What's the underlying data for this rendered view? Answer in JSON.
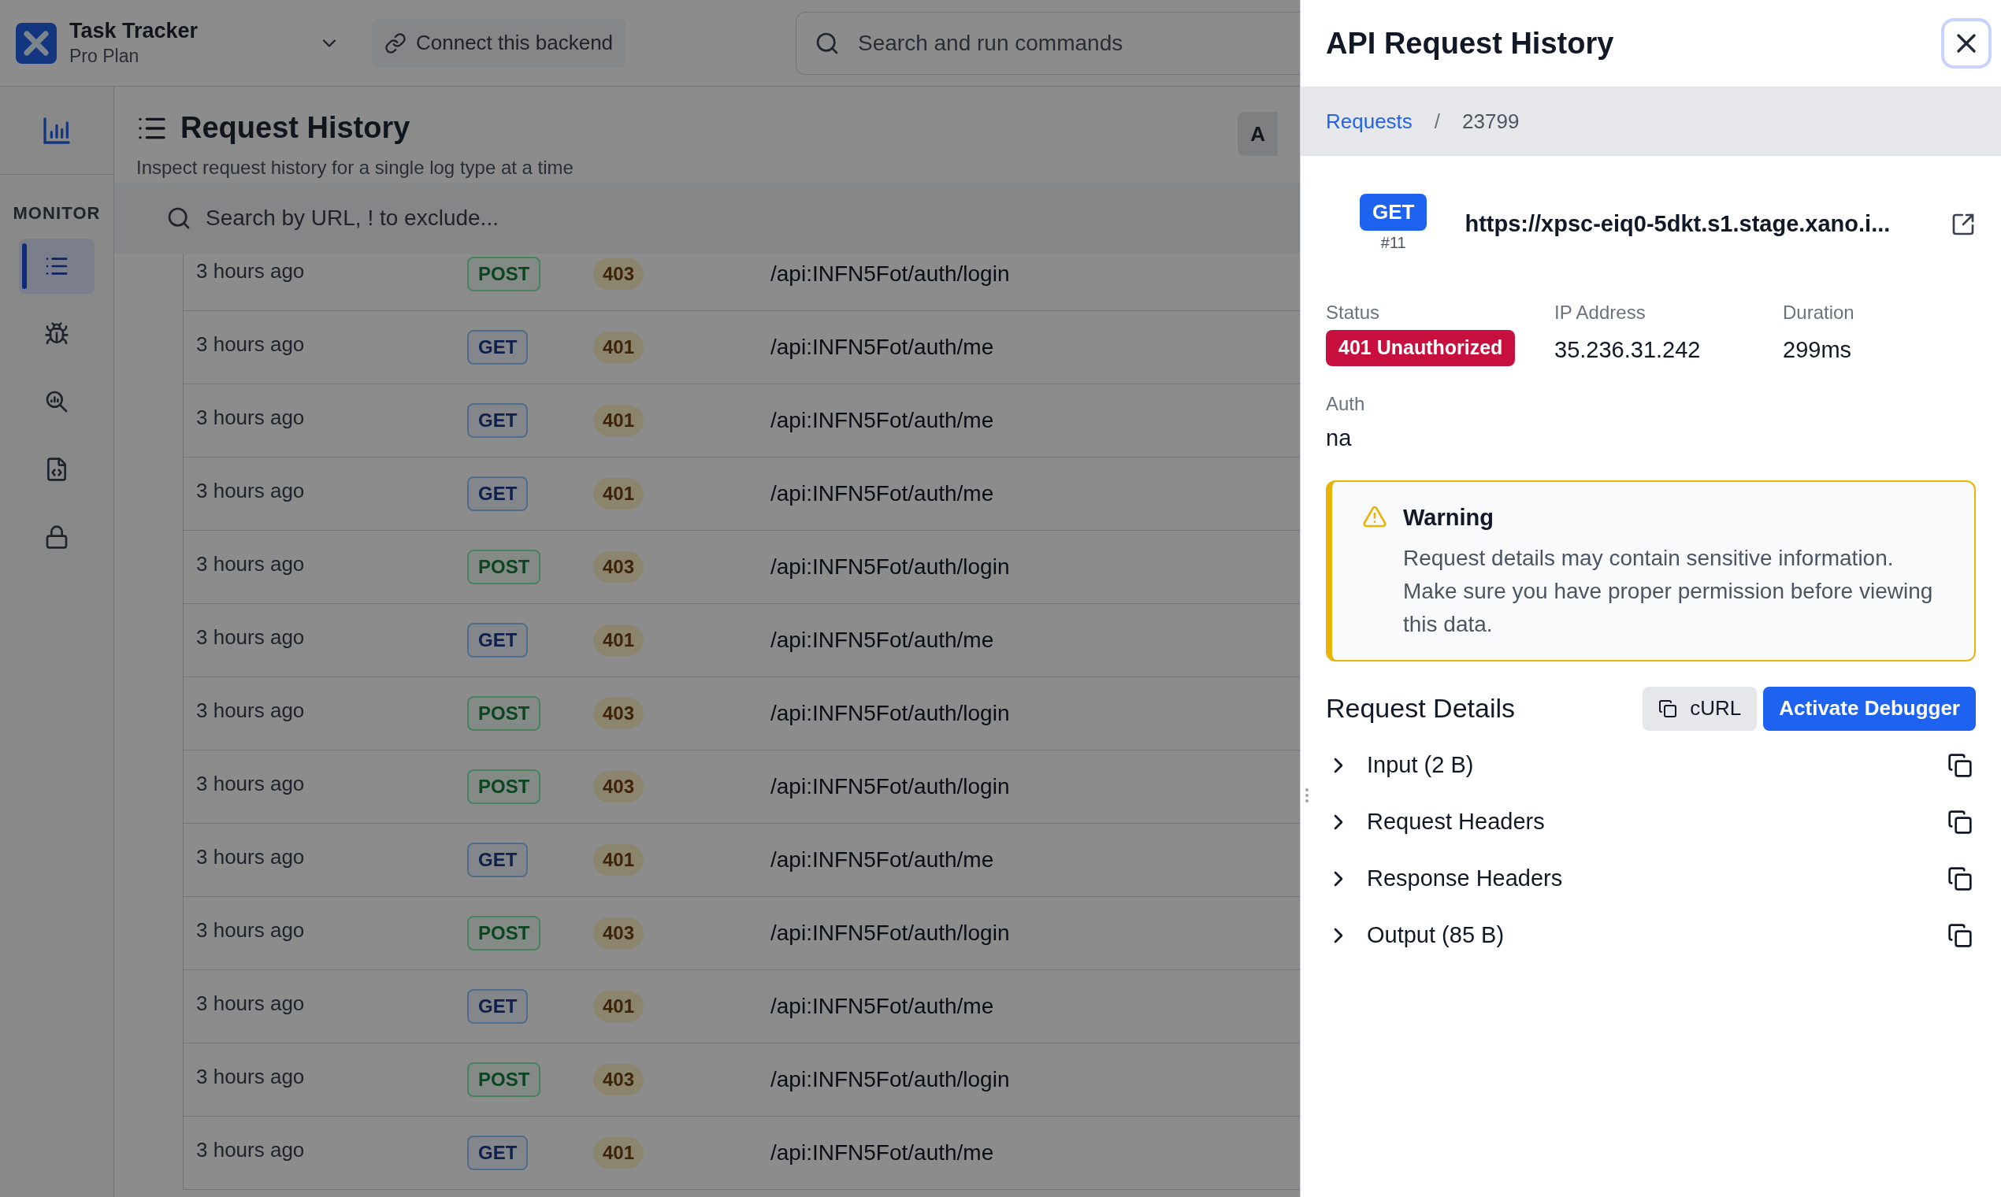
{
  "topbar": {
    "app_name": "Task Tracker",
    "plan": "Pro Plan",
    "connect_button": "Connect this backend",
    "search": {
      "placeholder": "Search and run commands"
    }
  },
  "sidebar": {
    "section_label": "MONITOR",
    "items": [
      {
        "kind": "list",
        "selected": true
      },
      {
        "kind": "bug",
        "selected": false
      },
      {
        "kind": "inspect",
        "selected": false
      },
      {
        "kind": "file",
        "selected": false
      },
      {
        "kind": "lock",
        "selected": false
      }
    ]
  },
  "page": {
    "title": "Request History",
    "subtitle": "Inspect request history for a single log type at a time",
    "cut_button": "A",
    "search": {
      "placeholder": "Search by URL, ! to exclude..."
    }
  },
  "rows": [
    {
      "time": "3 hours ago",
      "method": {
        "label": "POST",
        "kind": "post"
      },
      "status": "403",
      "path": "/api:INFN5Fot/auth/login"
    },
    {
      "time": "3 hours ago",
      "method": {
        "label": "GET",
        "kind": "get"
      },
      "status": "401",
      "path": "/api:INFN5Fot/auth/me"
    },
    {
      "time": "3 hours ago",
      "method": {
        "label": "GET",
        "kind": "get"
      },
      "status": "401",
      "path": "/api:INFN5Fot/auth/me"
    },
    {
      "time": "3 hours ago",
      "method": {
        "label": "GET",
        "kind": "get"
      },
      "status": "401",
      "path": "/api:INFN5Fot/auth/me"
    },
    {
      "time": "3 hours ago",
      "method": {
        "label": "POST",
        "kind": "post"
      },
      "status": "403",
      "path": "/api:INFN5Fot/auth/login"
    },
    {
      "time": "3 hours ago",
      "method": {
        "label": "GET",
        "kind": "get"
      },
      "status": "401",
      "path": "/api:INFN5Fot/auth/me"
    },
    {
      "time": "3 hours ago",
      "method": {
        "label": "POST",
        "kind": "post"
      },
      "status": "403",
      "path": "/api:INFN5Fot/auth/login"
    },
    {
      "time": "3 hours ago",
      "method": {
        "label": "POST",
        "kind": "post"
      },
      "status": "403",
      "path": "/api:INFN5Fot/auth/login"
    },
    {
      "time": "3 hours ago",
      "method": {
        "label": "GET",
        "kind": "get"
      },
      "status": "401",
      "path": "/api:INFN5Fot/auth/me"
    },
    {
      "time": "3 hours ago",
      "method": {
        "label": "POST",
        "kind": "post"
      },
      "status": "403",
      "path": "/api:INFN5Fot/auth/login"
    },
    {
      "time": "3 hours ago",
      "method": {
        "label": "GET",
        "kind": "get"
      },
      "status": "401",
      "path": "/api:INFN5Fot/auth/me"
    },
    {
      "time": "3 hours ago",
      "method": {
        "label": "POST",
        "kind": "post"
      },
      "status": "403",
      "path": "/api:INFN5Fot/auth/login"
    },
    {
      "time": "3 hours ago",
      "method": {
        "label": "GET",
        "kind": "get"
      },
      "status": "401",
      "path": "/api:INFN5Fot/auth/me"
    }
  ],
  "panel": {
    "title": "API Request History",
    "breadcrumb": {
      "link": "Requests",
      "separator": "/",
      "current": "23799"
    },
    "request": {
      "method": "GET",
      "number": "#11",
      "url": "https://xpsc-eiq0-5dkt.s1.stage.xano.i..."
    },
    "fields": [
      {
        "label": "Status",
        "value": "401 Unauthorized",
        "kind": "badge"
      },
      {
        "label": "IP Address",
        "value": "35.236.31.242",
        "kind": "text"
      },
      {
        "label": "Duration",
        "value": "299ms",
        "kind": "text"
      }
    ],
    "auth": {
      "label": "Auth",
      "value": "na"
    },
    "warning": {
      "title": "Warning",
      "text": "Request details may contain sensitive information. Make sure you have proper permission before viewing this data."
    },
    "details": {
      "title": "Request Details",
      "curl_button": "cURL",
      "debug_button": "Activate Debugger",
      "sections": [
        {
          "label": "Input (2 B)",
          "expanded": false
        },
        {
          "label": "Request Headers",
          "expanded": false
        },
        {
          "label": "Response Headers",
          "expanded": false
        },
        {
          "label": "Output (85 B)",
          "expanded": false
        }
      ]
    }
  }
}
